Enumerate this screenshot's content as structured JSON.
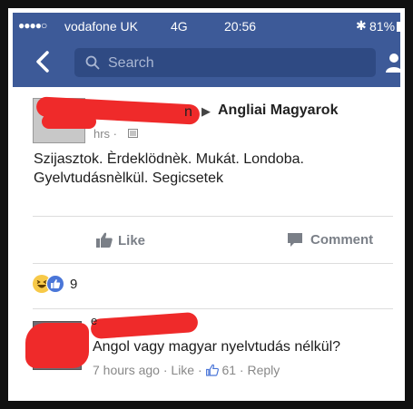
{
  "status_bar": {
    "signal": "●●●●○",
    "carrier": "vodafone UK",
    "network": "4G",
    "time": "20:56",
    "bluetooth": "✱",
    "battery": "81%"
  },
  "nav": {
    "search_placeholder": "Search"
  },
  "post": {
    "author_tail": "n",
    "group": "Angliai Magyarok",
    "meta": "hrs ·",
    "text_line1": "Szijasztok. Èrdeklödnèk. Mukát.   Londoba.",
    "text_line2": "Gyelvtudásnèlkül. Segicsetek",
    "like_label": "Like",
    "comment_label": "Comment",
    "reaction_count": "9"
  },
  "comment": {
    "author_letter": "e",
    "text": "Angol vagy magyar nyelvtudás nélkül?",
    "time": "7 hours ago",
    "like": "Like",
    "like_count": "61",
    "reply": "Reply"
  },
  "colors": {
    "header_blue": "#3d5a98",
    "redaction_red": "#ef2a2a"
  }
}
